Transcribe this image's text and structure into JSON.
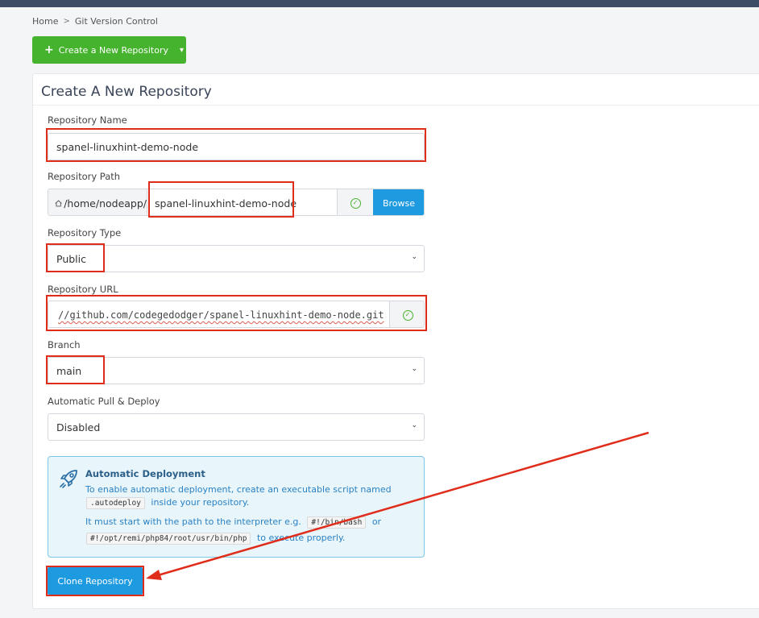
{
  "breadcrumb": {
    "home": "Home",
    "separator": ">",
    "current": "Git Version Control"
  },
  "create_button": {
    "plus": "+",
    "label": "Create a New Repository",
    "chevron": "⌄"
  },
  "panel": {
    "title": "Create A New Repository"
  },
  "form": {
    "repo_name": {
      "label": "Repository Name",
      "value": "spanel-linuxhint-demo-node"
    },
    "repo_path": {
      "label": "Repository Path",
      "prefix": "/home/nodeapp/",
      "value": "spanel-linuxhint-demo-node",
      "browse_label": "Browse"
    },
    "repo_type": {
      "label": "Repository Type",
      "value": "Public"
    },
    "repo_url": {
      "label": "Repository URL",
      "value": "//github.com/codegedodger/spanel-linuxhint-demo-node.git"
    },
    "branch": {
      "label": "Branch",
      "value": "main"
    },
    "auto_pull": {
      "label": "Automatic Pull & Deploy",
      "value": "Disabled"
    }
  },
  "info_box": {
    "title": "Automatic Deployment",
    "line1": "To enable automatic deployment, create an executable script named",
    "code1": ".autodeploy",
    "line2_suffix": "inside your repository.",
    "line3_prefix": "It must start with the path to the interpreter e.g.",
    "code2": "#!/bin/bash",
    "line3_or": "or",
    "code3": "#!/opt/remi/php84/root/usr/bin/php",
    "line4_suffix": "to execute properly."
  },
  "clone_button": {
    "label": "Clone Repository"
  },
  "icons": {
    "home": "home-icon",
    "check": "check-circle-icon",
    "rocket": "rocket-icon",
    "select": "chevron-down-icon"
  },
  "colors": {
    "green": "#45b32d",
    "blue": "#1e9ae0",
    "annotation_red": "#e02d1b",
    "topbar": "#3e4d66"
  }
}
